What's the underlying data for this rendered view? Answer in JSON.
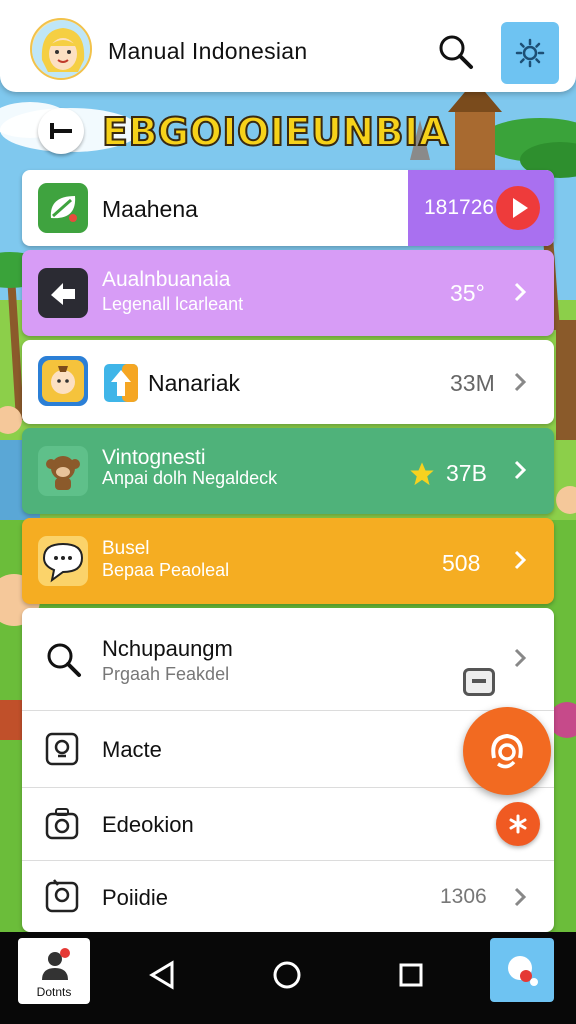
{
  "header": {
    "title": "Manual  Indonesian",
    "search_icon": "search-icon",
    "settings_icon": "gear-icon"
  },
  "banner": {
    "title": "EBGOIOIEUNBIA",
    "back_icon": "back-arrow-icon"
  },
  "items": [
    {
      "label": "Maahena",
      "value": "181726",
      "icon": "leaf-app-icon",
      "action_icon": "play-icon",
      "bg": "#ffffff",
      "accent": "#a970f0"
    },
    {
      "label": "Aualnbuanaia",
      "sub": "Legenall lcarleant",
      "value": "35°",
      "icon": "share-app-icon",
      "bg": "#d79cf6"
    },
    {
      "label": "Nanariak",
      "value": "33M",
      "icon": "character-app-icon",
      "bg": "#ffffff"
    },
    {
      "label": "Vintognesti",
      "sub": "Anpai dolh Negaldeck",
      "value": "37B",
      "icon": "monkey-app-icon",
      "star_icon": "star-icon",
      "bg": "#4fb27a"
    },
    {
      "label": "Busel",
      "sub": "Bepaa Peaoleal",
      "value": "508",
      "icon": "chat-bubble-icon",
      "bg": "#f5ad22"
    }
  ],
  "list": [
    {
      "label": "Nchupaungm",
      "sub": "Prgaah Feakdel",
      "icon": "search-icon"
    },
    {
      "label": "Macte",
      "icon": "phone-icon"
    },
    {
      "label": "Edeokion",
      "icon": "camera-icon"
    },
    {
      "label": "Poiidie",
      "value": "1306",
      "icon": "gallery-icon"
    }
  ],
  "fab": {
    "icon": "headset-icon"
  },
  "fab_small": {
    "icon": "asterisk-icon"
  },
  "navbar": {
    "app_label": "Dotnts",
    "back_icon": "back-triangle-icon",
    "home_icon": "home-circle-icon",
    "recents_icon": "recents-square-icon"
  }
}
